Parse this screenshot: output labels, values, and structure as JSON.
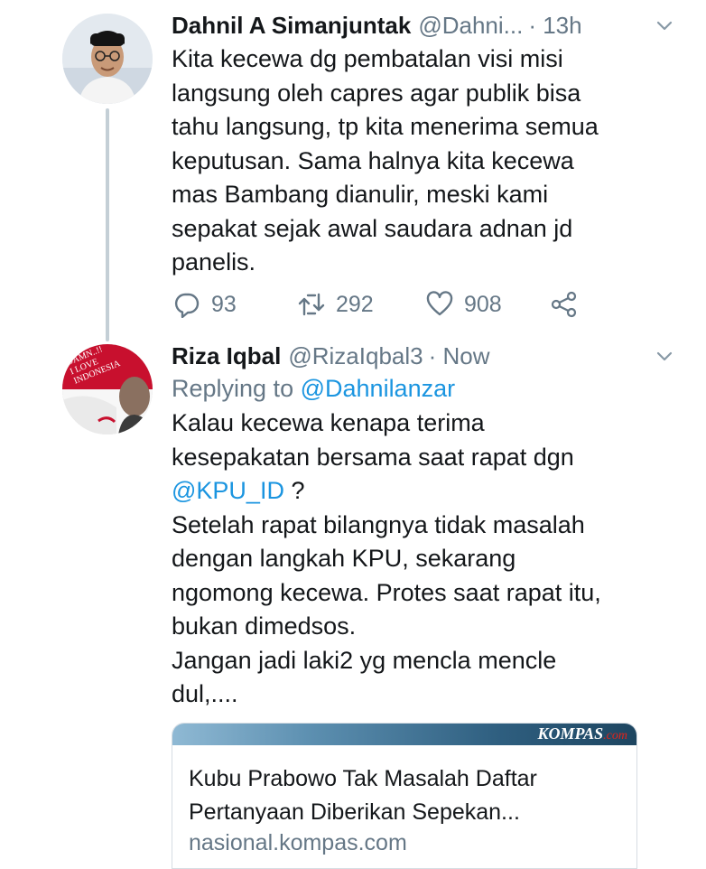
{
  "tweet1": {
    "name": "Dahnil A Simanjuntak",
    "handle": "@Dahni...",
    "time": "· 13h",
    "lines": [
      "Kita kecewa dg pembatalan visi misi",
      "langsung oleh capres agar publik bisa",
      "tahu langsung, tp kita menerima semua",
      "keputusan. Sama halnya kita kecewa",
      "mas Bambang dianulir, meski kami",
      "sepakat sejak awal saudara adnan jd",
      "panelis."
    ],
    "actions": {
      "replies": "93",
      "retweets": "292",
      "likes": "908"
    }
  },
  "tweet2": {
    "name": "Riza Iqbal",
    "handle": "@RizaIqbal3",
    "time": "· Now",
    "replying_prefix": "Replying to",
    "replying_handle": "@Dahnilanzar",
    "avatar_text": [
      "DAMN..!!",
      "I LOVE",
      "INDONESIA"
    ],
    "lines_a": [
      "Kalau kecewa kenapa terima",
      "kesepakatan bersama saat rapat dgn"
    ],
    "mention": "@KPU_ID",
    "mention_suffix": " ?",
    "lines_b": [
      "Setelah rapat bilangnya tidak masalah",
      "dengan langkah KPU, sekarang",
      "ngomong kecewa. Protes saat rapat itu,",
      "bukan dimedsos.",
      "Jangan jadi laki2 yg mencla mencle",
      "dul,...."
    ]
  },
  "card": {
    "brand": "KOMPAS",
    "brand_suffix": ".com",
    "title_line1": "Kubu Prabowo Tak Masalah Daftar",
    "title_line2": "Pertanyaan Diberikan Sepekan...",
    "domain": "nasional.kompas.com"
  },
  "icons": {
    "reply": "reply-icon",
    "retweet": "retweet-icon",
    "like": "heart-icon",
    "share": "share-icon",
    "menu": "chevron-down-icon"
  },
  "colors": {
    "link": "#1b95e0",
    "secondary": "#657786",
    "thread_line": "#c4cfd6"
  }
}
